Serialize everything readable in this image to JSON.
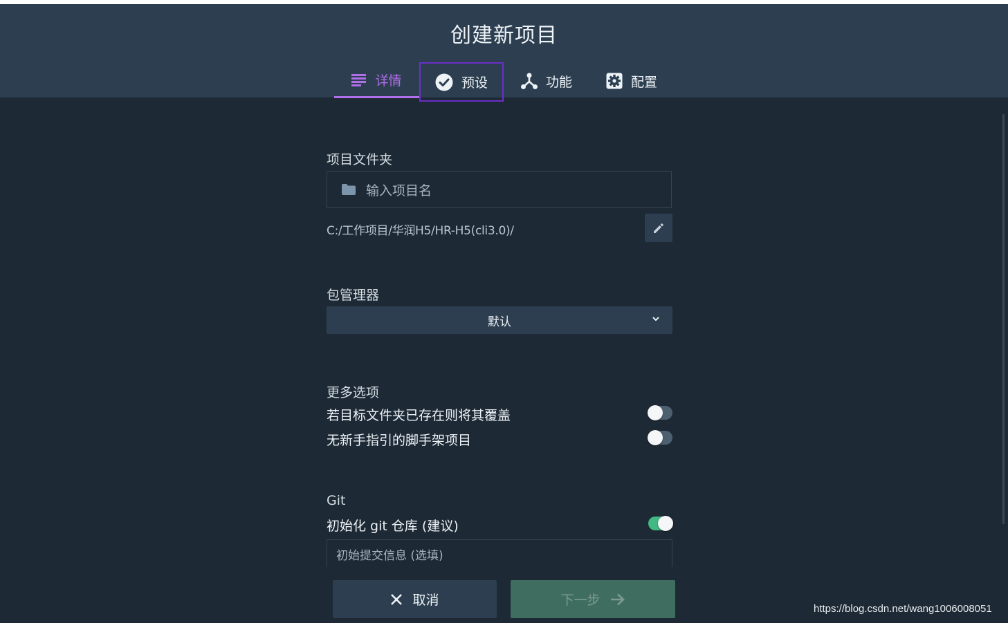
{
  "header": {
    "title": "创建新项目",
    "tabs": [
      {
        "label": "详情",
        "icon": "list-icon",
        "active": true
      },
      {
        "label": "预设",
        "icon": "check-circle-icon",
        "active": false
      },
      {
        "label": "功能",
        "icon": "fork-icon",
        "active": false
      },
      {
        "label": "配置",
        "icon": "gear-icon",
        "active": false
      }
    ]
  },
  "project_folder": {
    "label": "项目文件夹",
    "placeholder": "输入项目名",
    "path": "C:/工作项目/华润H5/HR-H5(cli3.0)/"
  },
  "package_manager": {
    "label": "包管理器",
    "selected": "默认"
  },
  "more_options": {
    "label": "更多选项",
    "overwrite_label": "若目标文件夹已存在则将其覆盖",
    "overwrite_on": false,
    "no_guide_label": "无新手指引的脚手架项目",
    "no_guide_on": false
  },
  "git": {
    "label": "Git",
    "init_label": "初始化 git 仓库 (建议)",
    "init_on": true,
    "commit_placeholder": "初始提交信息 (选填)"
  },
  "footer": {
    "cancel_label": "取消",
    "next_label": "下一步"
  },
  "watermark": "https://blog.csdn.net/wang1006008051",
  "colors": {
    "accent": "#b06ee8",
    "header_bg": "#2c3e50",
    "page_bg": "#1d2935",
    "toggle_on": "#42b883"
  }
}
